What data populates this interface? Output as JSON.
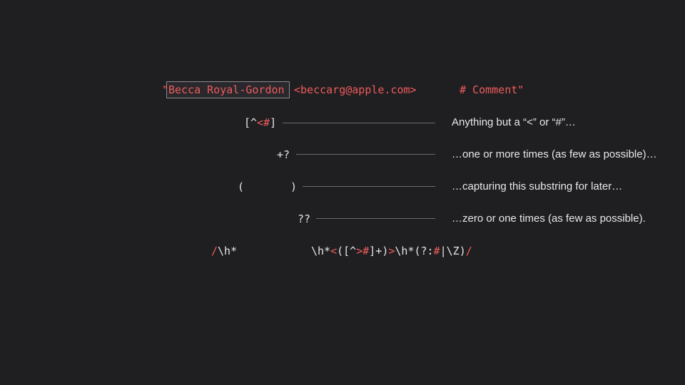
{
  "sample": {
    "open_quote": "\"",
    "name": "Becca Royal-Gordon",
    "email": "<beccarg@apple.com>",
    "comment": "# Comment\""
  },
  "rows": [
    {
      "pattern_prefix": "[^",
      "pattern_red": "<#",
      "pattern_suffix": "]",
      "description": "Anything but a “<” or “#”…"
    },
    {
      "pattern": "+?",
      "description": "…one or more times (as few as possible)…"
    },
    {
      "pattern_open": "(",
      "pattern_close": ")",
      "description": "…capturing this substring for later…"
    },
    {
      "pattern": "??",
      "description": "…zero or one times (as few as possible)."
    }
  ],
  "regex": {
    "part1_red": "/",
    "part1": "\\h*",
    "part2": "\\h*",
    "part3_red": "<",
    "part4": "([^",
    "part5_red": ">#",
    "part6": "]+)",
    "part7_red": ">",
    "part8": "\\h*(?:",
    "part9_red": "#",
    "part10": "|\\Z)",
    "part11_red": "/"
  }
}
